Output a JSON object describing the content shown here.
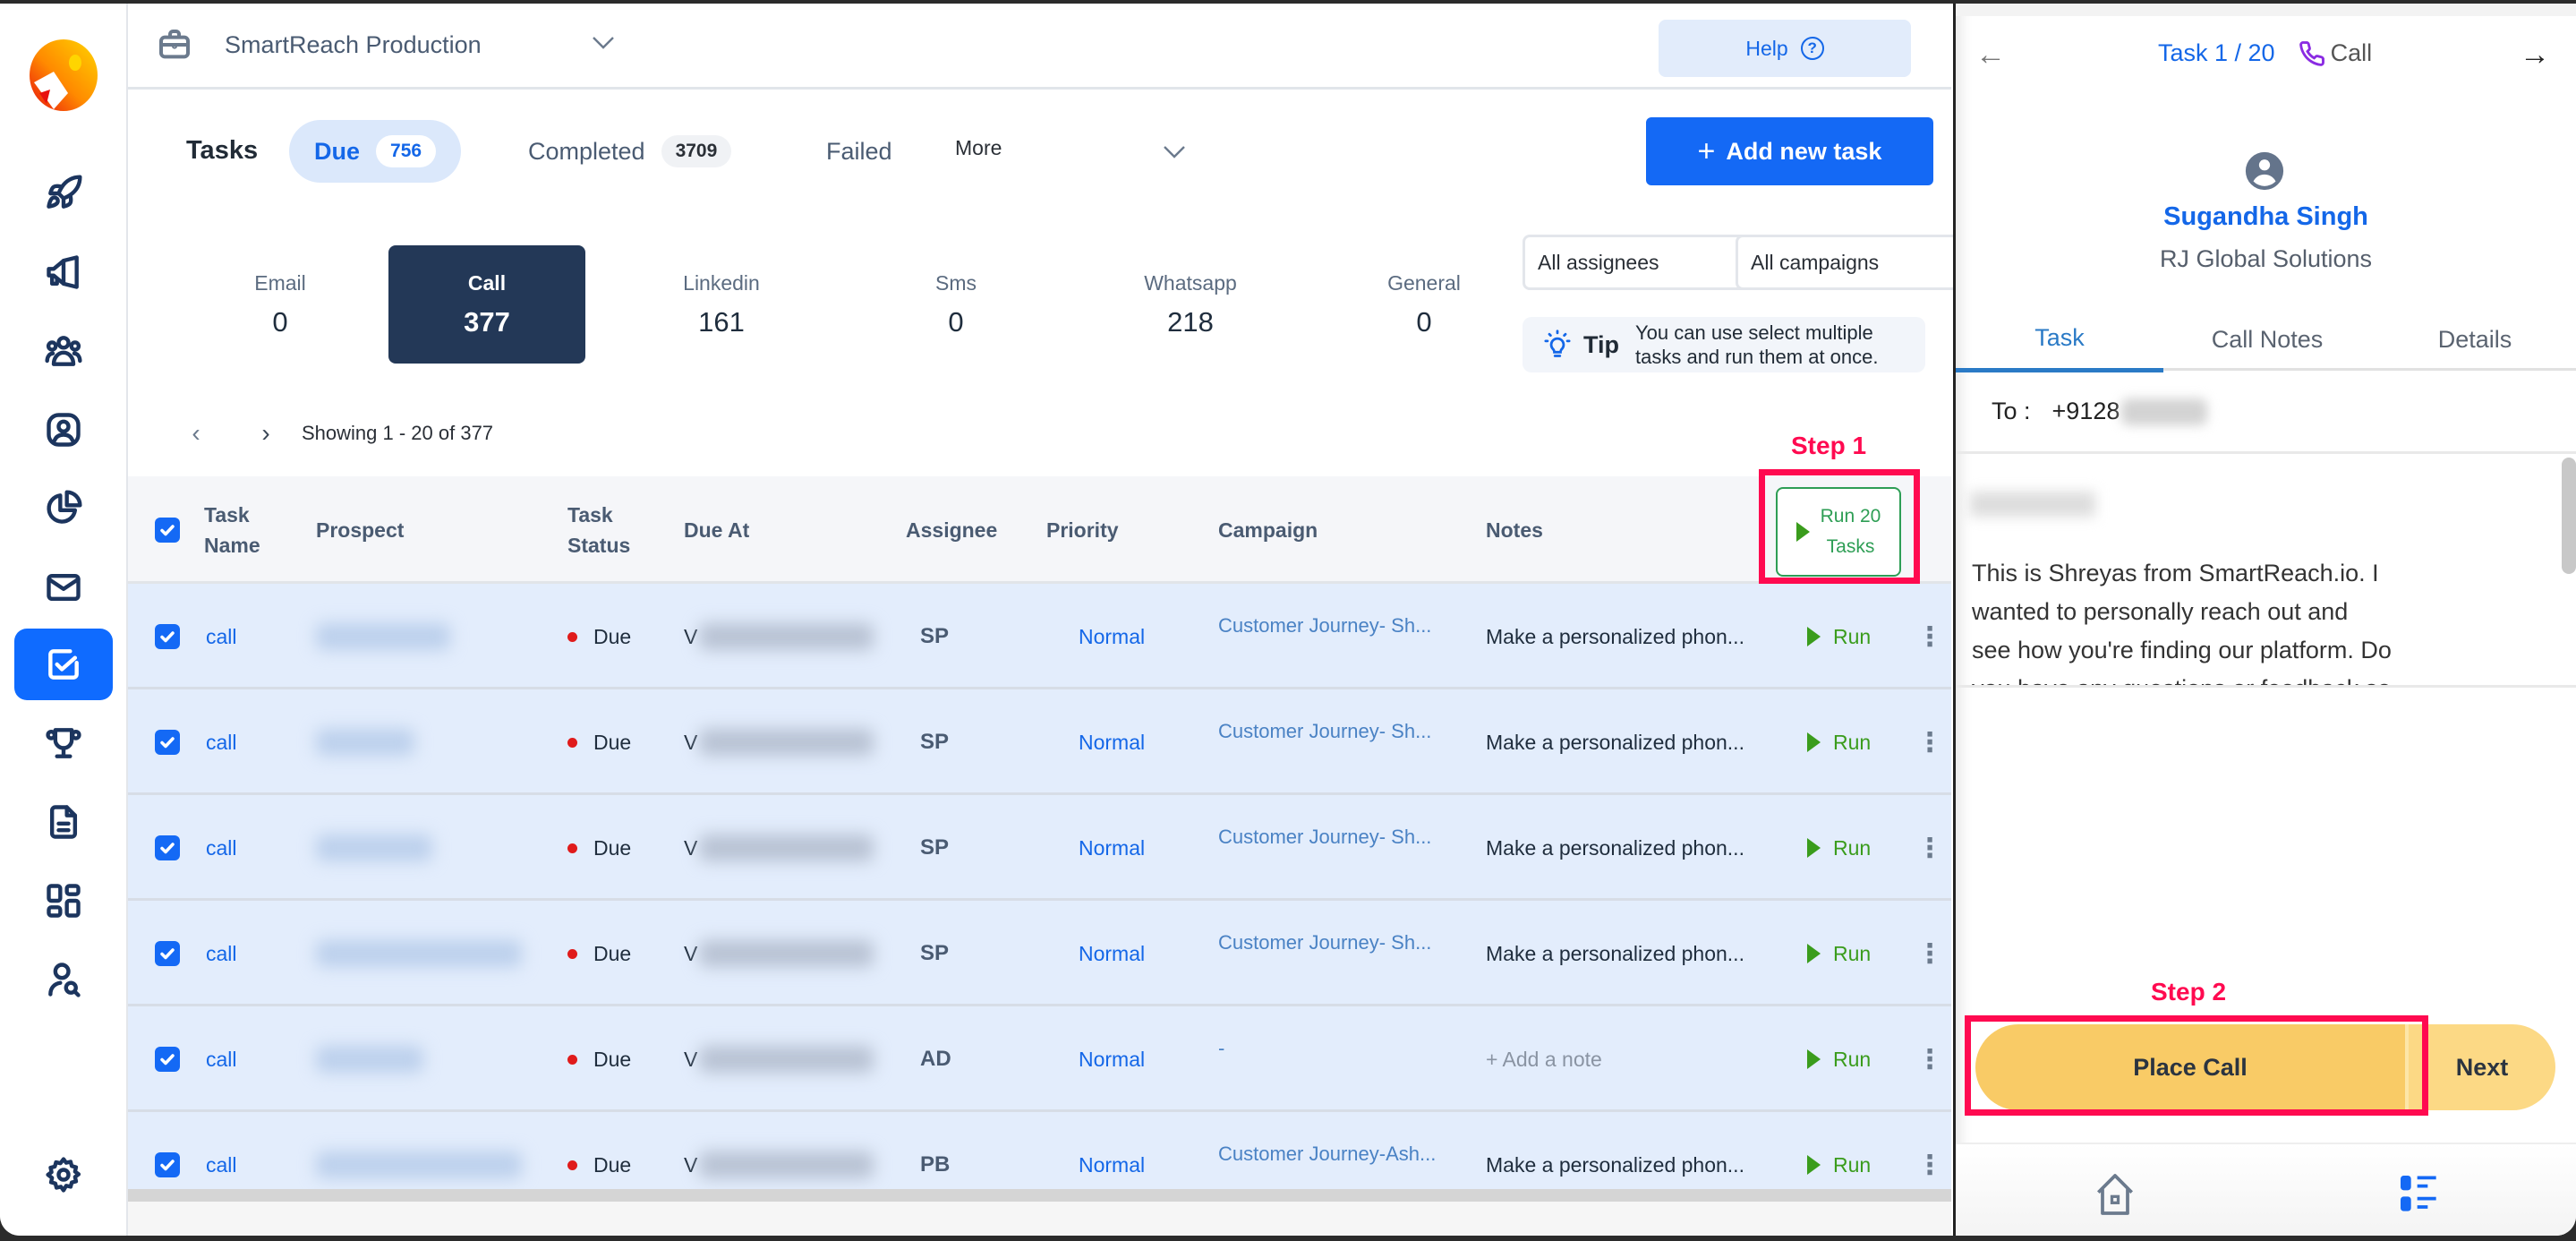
{
  "workspace": {
    "name": "SmartReach Production",
    "help_label": "Help"
  },
  "sidebar": {
    "items": [
      {
        "name": "rocket-icon"
      },
      {
        "name": "megaphone-icon"
      },
      {
        "name": "users-icon"
      },
      {
        "name": "contact-icon"
      },
      {
        "name": "pie-chart-icon"
      },
      {
        "name": "mail-icon"
      },
      {
        "name": "tasks-icon",
        "active": true
      },
      {
        "name": "trophy-icon"
      },
      {
        "name": "document-icon"
      },
      {
        "name": "grid-icon"
      },
      {
        "name": "user-search-icon"
      }
    ],
    "settings": "gear-icon"
  },
  "tasks": {
    "title": "Tasks",
    "tabs": [
      {
        "label": "Due",
        "count": "756",
        "active": true
      },
      {
        "label": "Completed",
        "count": "3709"
      },
      {
        "label": "Failed"
      }
    ],
    "more_label": "More",
    "add_task_label": "Add new task"
  },
  "channels": [
    {
      "label": "Email",
      "count": "0"
    },
    {
      "label": "Call",
      "count": "377",
      "active": true
    },
    {
      "label": "Linkedin",
      "count": "161"
    },
    {
      "label": "Sms",
      "count": "0"
    },
    {
      "label": "Whatsapp",
      "count": "218"
    },
    {
      "label": "General",
      "count": "0"
    }
  ],
  "filters": {
    "assignees": "All assignees",
    "campaigns": "All campaigns"
  },
  "tip": {
    "label": "Tip",
    "text": "You can use select multiple tasks and run them at once."
  },
  "pagination": {
    "text": "Showing 1 - 20 of 377"
  },
  "table": {
    "headers": {
      "task_name_1": "Task",
      "task_name_2": "Name",
      "prospect": "Prospect",
      "task_status_1": "Task",
      "task_status_2": "Status",
      "due_at": "Due At",
      "assignee": "Assignee",
      "priority": "Priority",
      "campaign": "Campaign",
      "notes": "Notes",
      "run_all_1": "Run 20",
      "run_all_2": "Tasks"
    },
    "rows": [
      {
        "task": "call",
        "status": "Due",
        "due_prefix": "V",
        "assignee": "SP",
        "priority": "Normal",
        "campaign": "Customer Journey- Sh...",
        "notes": "Make a personalized phon...",
        "run": "Run"
      },
      {
        "task": "call",
        "status": "Due",
        "due_prefix": "V",
        "assignee": "SP",
        "priority": "Normal",
        "campaign": "Customer Journey- Sh...",
        "notes": "Make a personalized phon...",
        "run": "Run"
      },
      {
        "task": "call",
        "status": "Due",
        "due_prefix": "V",
        "assignee": "SP",
        "priority": "Normal",
        "campaign": "Customer Journey- Sh...",
        "notes": "Make a personalized phon...",
        "run": "Run"
      },
      {
        "task": "call",
        "status": "Due",
        "due_prefix": "V",
        "assignee": "SP",
        "priority": "Normal",
        "campaign": "Customer Journey- Sh...",
        "notes": "Make a personalized phon...",
        "run": "Run"
      },
      {
        "task": "call",
        "status": "Due",
        "due_prefix": "V",
        "assignee": "AD",
        "priority": "Normal",
        "campaign": "-",
        "notes": "+ Add a note",
        "notes_placeholder": true,
        "run": "Run"
      },
      {
        "task": "call",
        "status": "Due",
        "due_prefix": "V",
        "assignee": "PB",
        "priority": "Normal",
        "campaign": "Customer Journey-Ash...",
        "notes": "Make a personalized phon...",
        "run": "Run"
      }
    ]
  },
  "annotations": {
    "step1": "Step 1",
    "step2": "Step 2"
  },
  "panel": {
    "task_counter": "Task 1 / 20",
    "task_type": "Call",
    "prospect_name": "Sugandha Singh",
    "company": "RJ Global Solutions",
    "tabs": [
      {
        "label": "Task",
        "active": true
      },
      {
        "label": "Call Notes"
      },
      {
        "label": "Details"
      }
    ],
    "to_label": "To :",
    "to_value": "+9128",
    "script": "This is Shreyas from SmartReach.io. I wanted to personally reach out and see how you're finding our platform. Do you have any questions or feedback so far?",
    "place_call_label": "Place Call",
    "next_label": "Next"
  },
  "colors": {
    "primary": "#1469f5",
    "nav_active": "#233857",
    "run_green": "#3a9c1c",
    "annotation": "#ff0a50",
    "place_call": "#f9cb66",
    "due_dot": "#e01b1b"
  }
}
